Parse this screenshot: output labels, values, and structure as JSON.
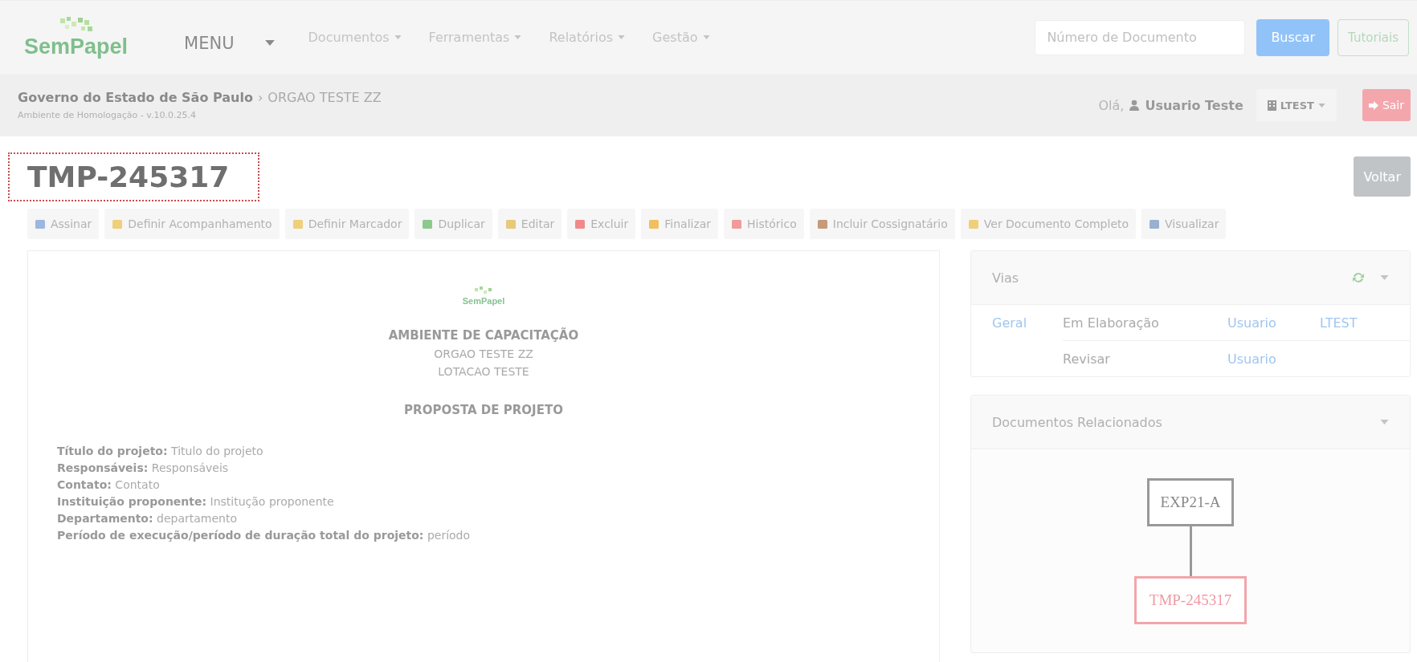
{
  "header": {
    "logo": "SemPapel",
    "menu": [
      {
        "label": "MENU",
        "kind": "main"
      },
      {
        "label": "Documentos",
        "kind": "dropdown"
      },
      {
        "label": "Ferramentas",
        "kind": "dropdown"
      },
      {
        "label": "Relatórios",
        "kind": "dropdown"
      },
      {
        "label": "Gestão",
        "kind": "dropdown"
      }
    ],
    "search": {
      "placeholder": "Número de Documento"
    },
    "search_button": "Buscar",
    "tutorials_button": "Tutoriais"
  },
  "breadcrumb": {
    "org": "Governo do Estado de São Paulo",
    "separator": "›",
    "unit": "ORGAO TESTE ZZ",
    "environment": "Ambiente de Homologação - v.10.0.25.4",
    "greeting": "Olá,",
    "user": "Usuario Teste",
    "lotacao": "LTEST",
    "logout": "Sair"
  },
  "document": {
    "title": "TMP-245317",
    "focused": true,
    "back_button": "Voltar"
  },
  "actions": [
    {
      "label": "Assinar"
    },
    {
      "label": "Definir Acompanhamento"
    },
    {
      "label": "Definir Marcador"
    },
    {
      "label": "Duplicar"
    },
    {
      "label": "Editar"
    },
    {
      "label": "Excluir"
    },
    {
      "label": "Finalizar"
    },
    {
      "label": "Histórico"
    },
    {
      "label": "Incluir Cossignatário"
    },
    {
      "label": "Ver Documento Completo"
    },
    {
      "label": "Visualizar"
    }
  ],
  "preview": {
    "logo": "SemPapel",
    "heading": "AMBIENTE DE CAPACITAÇÃO",
    "lines": [
      "ORGAO TESTE ZZ",
      "LOTACAO TESTE"
    ],
    "subject": "PROPOSTA DE PROJETO",
    "fields": [
      {
        "label": "Título do projeto:",
        "value": "Titulo do projeto"
      },
      {
        "label": "Responsáveis:",
        "value": "Responsáveis"
      },
      {
        "label": "Contato:",
        "value": "Contato"
      },
      {
        "label": "Instituição proponente:",
        "value": "Institução proponente"
      },
      {
        "label": "Departamento:",
        "value": "departamento"
      },
      {
        "label": "Período de execução/período de duração total do projeto:",
        "value": "período"
      }
    ]
  },
  "vias": {
    "title": "Vias",
    "rows": [
      {
        "via": "Geral",
        "status": "Em Elaboração",
        "user": "Usuario",
        "lotacao": "LTEST"
      },
      {
        "status": "Revisar",
        "user": "Usuario"
      }
    ]
  },
  "related": {
    "title": "Documentos Relacionados",
    "nodes": [
      {
        "label": "EXP21-A",
        "current": false
      },
      {
        "label": "TMP-245317",
        "current": true
      }
    ]
  }
}
